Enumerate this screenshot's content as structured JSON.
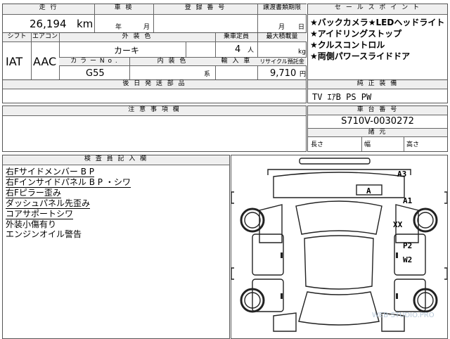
{
  "top": {
    "h_mileage": "走 行",
    "h_shaken": "車 検",
    "h_reg_no": "登 録 番 号",
    "h_transfer": "譲渡書類期限",
    "h_sales_points": "セ ー ル ス ポ イ ン ト",
    "mileage_value": "26,194",
    "mileage_unit": "km",
    "shaken_year": "年",
    "shaken_month": "月",
    "transfer_month": "月",
    "transfer_day": "日"
  },
  "spec": {
    "h_shift": "シフト",
    "h_ac": "エアコン",
    "h_exterior": "外 装 色",
    "h_capacity": "乗車定員",
    "h_load": "最大積載量",
    "shift": "IAT",
    "ac": "AAC",
    "exterior_color": "カーキ",
    "capacity": "4",
    "capacity_unit": "人",
    "load_unit": "kg",
    "h_color_no": "カ ラ ー N o .",
    "h_interior": "内 装 色",
    "h_import": "輸 入 車",
    "h_recycle": "リサイクル預託金",
    "color_no": "G55",
    "interior_unit": "系",
    "recycle_value": "9,710",
    "recycle_unit": "円"
  },
  "sales_points": [
    "★バックカメラ★LEDヘッドライト",
    "★アイドリングストップ",
    "★クルスコントロル",
    "★両側パワースライドドア"
  ],
  "later": {
    "h_later_docs": "後 日 発 送 部 品"
  },
  "equipment": {
    "h_genuine": "純 正 装 備",
    "value": "TV ｴｱB PS PW"
  },
  "notes": {
    "h_notes": "注 意 事 項 欄"
  },
  "chassis": {
    "h_chassis_no": "車 台 番 号",
    "value": "S710V-0030272"
  },
  "dims": {
    "h_specs": "諸 元",
    "length": "長さ",
    "width": "幅",
    "height": "高さ"
  },
  "inspector": {
    "h_title": "検 査 員 記 入 欄",
    "lines": [
      "右Fサイドメンバー B P",
      "右Fインサイドパネル B P ・シワ",
      "右Fピラー歪み",
      "ダッシュパネル先歪み",
      "コアサポートシワ",
      "外装小傷有り",
      "エンジンオイル警告"
    ]
  },
  "diagram_marks": {
    "a3": "A3",
    "a_front": "A",
    "a1": "A1",
    "xx": "XX",
    "p2": "P2",
    "w2": "W2"
  },
  "watermark": "WEB-STUDIO.PRO"
}
